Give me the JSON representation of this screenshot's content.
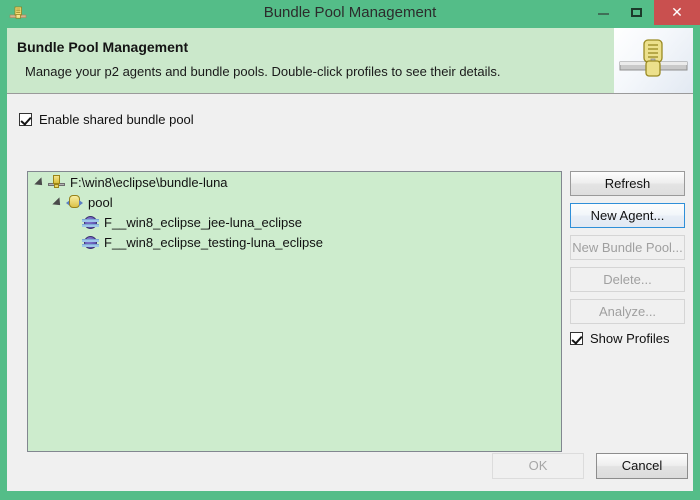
{
  "window": {
    "title": "Bundle Pool Management",
    "icon": "p2-agent-icon",
    "controls": {
      "minimize": "–",
      "maximize": "□",
      "close": "✕"
    },
    "colors": {
      "titlebar": "#54bd88",
      "banner": "#cbe8cb",
      "body": "#f0f0f0",
      "tree": "#cdeccd",
      "close_button": "#c9504f",
      "focus_border": "#2f8fd8"
    }
  },
  "banner": {
    "title": "Bundle Pool Management",
    "description": "Manage your p2 agents and bundle pools. Double-click profiles to see their details.",
    "image": "bundle-pool-banner-icon"
  },
  "enable_shared_pool": {
    "label": "Enable shared bundle pool",
    "checked": true
  },
  "tree": {
    "items": [
      {
        "label": "F:\\win8\\eclipse\\bundle-luna",
        "icon": "agent-icon",
        "level": 0,
        "expanded": true
      },
      {
        "label": "pool",
        "icon": "pool-icon",
        "level": 1,
        "expanded": true
      },
      {
        "label": "F__win8_eclipse_jee-luna_eclipse",
        "icon": "profile-icon",
        "level": 2,
        "expanded": false
      },
      {
        "label": "F__win8_eclipse_testing-luna_eclipse",
        "icon": "profile-icon",
        "level": 2,
        "expanded": false
      }
    ]
  },
  "side_buttons": [
    {
      "label": "Refresh",
      "enabled": true,
      "focused": false
    },
    {
      "label": "New Agent...",
      "enabled": true,
      "focused": true
    },
    {
      "label": "New Bundle Pool...",
      "enabled": false,
      "focused": false
    },
    {
      "label": "Delete...",
      "enabled": false,
      "focused": false
    },
    {
      "label": "Analyze...",
      "enabled": false,
      "focused": false
    }
  ],
  "show_profiles": {
    "label": "Show Profiles",
    "checked": true
  },
  "bottom_buttons": {
    "ok": {
      "label": "OK",
      "enabled": false
    },
    "cancel": {
      "label": "Cancel",
      "enabled": true
    }
  }
}
